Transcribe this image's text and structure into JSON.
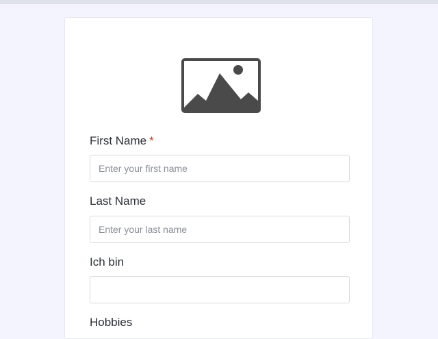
{
  "form": {
    "logo_icon": "image-placeholder-icon",
    "first_name": {
      "label": "First Name",
      "required_mark": "*",
      "placeholder": "Enter your first name",
      "value": ""
    },
    "last_name": {
      "label": "Last Name",
      "placeholder": "Enter your last name",
      "value": ""
    },
    "ich_bin": {
      "label": "Ich bin",
      "value": ""
    },
    "hobbies": {
      "label": "Hobbies"
    }
  },
  "colors": {
    "page_background": "#f3f4fd",
    "card_background": "#ffffff",
    "required_mark": "#c8392b",
    "icon": "#4a4a4a"
  }
}
